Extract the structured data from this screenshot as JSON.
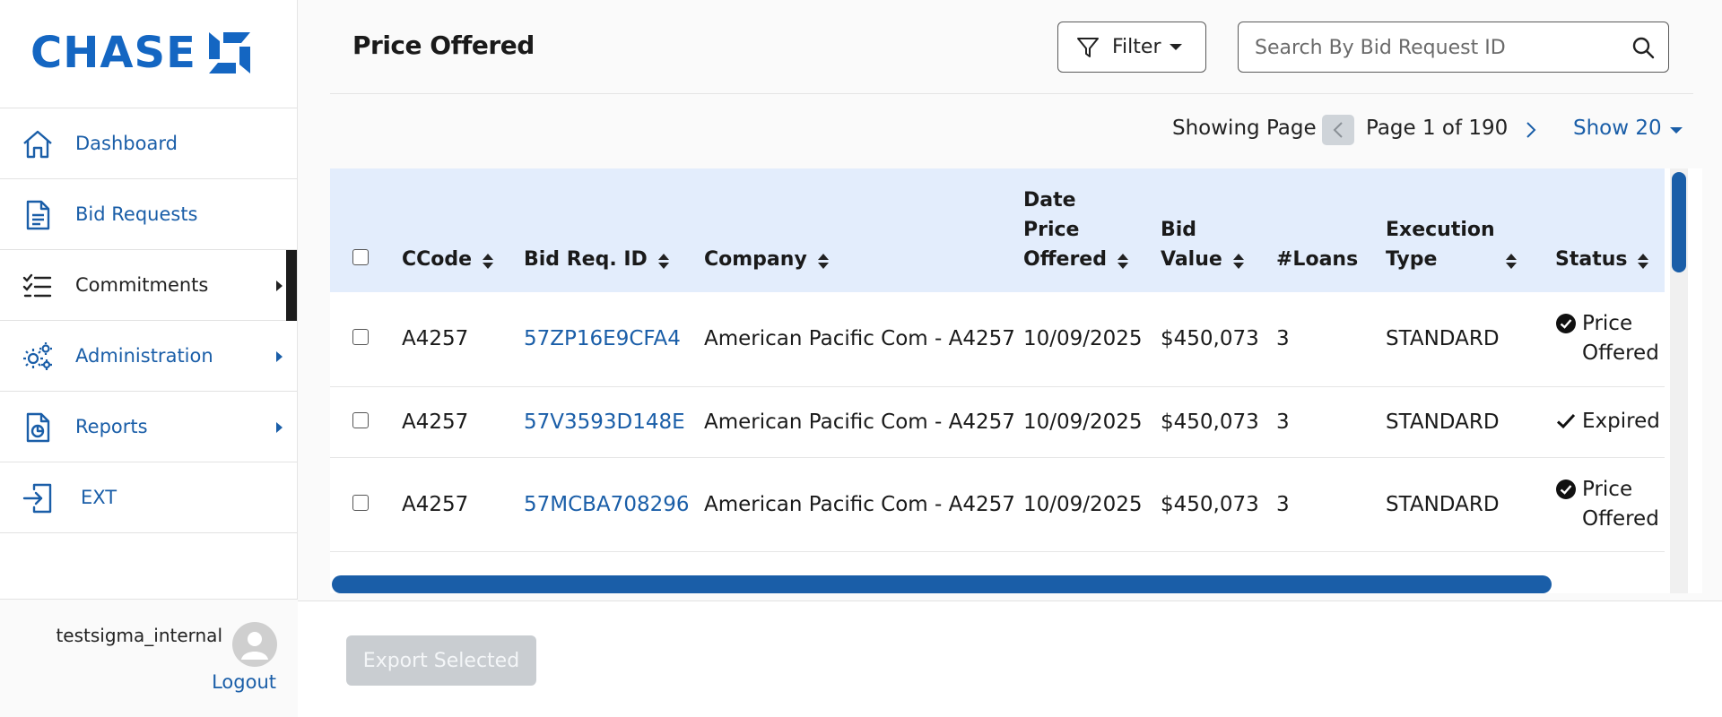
{
  "brand": {
    "name": "CHASE",
    "color": "#1466c2"
  },
  "sidebar": {
    "items": [
      {
        "label": "Dashboard",
        "icon": "home-icon"
      },
      {
        "label": "Bid Requests",
        "icon": "document-icon"
      },
      {
        "label": "Commitments",
        "icon": "checklist-icon"
      },
      {
        "label": "Administration",
        "icon": "gears-icon"
      },
      {
        "label": "Reports",
        "icon": "report-icon"
      },
      {
        "label": "EXT",
        "icon": "exit-icon"
      }
    ],
    "user": {
      "name": "testsigma_internal",
      "logout": "Logout"
    }
  },
  "header": {
    "title": "Price Offered",
    "filter_label": "Filter",
    "search_placeholder": "Search By Bid Request ID"
  },
  "pager": {
    "showing": "Showing Page",
    "page_info": "Page 1 of 190",
    "show": "Show 20"
  },
  "table": {
    "columns": [
      "CCode",
      "Bid Req. ID",
      "Company",
      "Date Price Offered",
      "Bid Value",
      "#Loans",
      "Execution Type",
      "Status"
    ],
    "header_lines": {
      "date": [
        "Date",
        "Price",
        "Offered"
      ],
      "bid_value": [
        "Bid",
        "Value"
      ],
      "execution": [
        "Execution",
        "Type"
      ]
    },
    "rows": [
      {
        "ccode": "A4257",
        "bid_id": "57ZP16E9CFA4",
        "company": "American Pacific Com - A4257",
        "date": "10/09/2025",
        "value": "$450,073",
        "loans": "3",
        "exec": "STANDARD",
        "status": [
          "Price",
          "Offered"
        ]
      },
      {
        "ccode": "A4257",
        "bid_id": "57V3593D148E",
        "company": "American Pacific Com - A4257",
        "date": "10/09/2025",
        "value": "$450,073",
        "loans": "3",
        "exec": "STANDARD",
        "status": [
          "Expired"
        ]
      },
      {
        "ccode": "A4257",
        "bid_id": "57MCBA708296",
        "company": "American Pacific Com - A4257",
        "date": "10/09/2025",
        "value": "$450,073",
        "loans": "3",
        "exec": "STANDARD",
        "status": [
          "Price",
          "Offered"
        ]
      }
    ]
  },
  "footer": {
    "export_label": "Export Selected"
  },
  "colors": {
    "accent": "#1a5ea8",
    "header_bg": "#e3edfc"
  }
}
